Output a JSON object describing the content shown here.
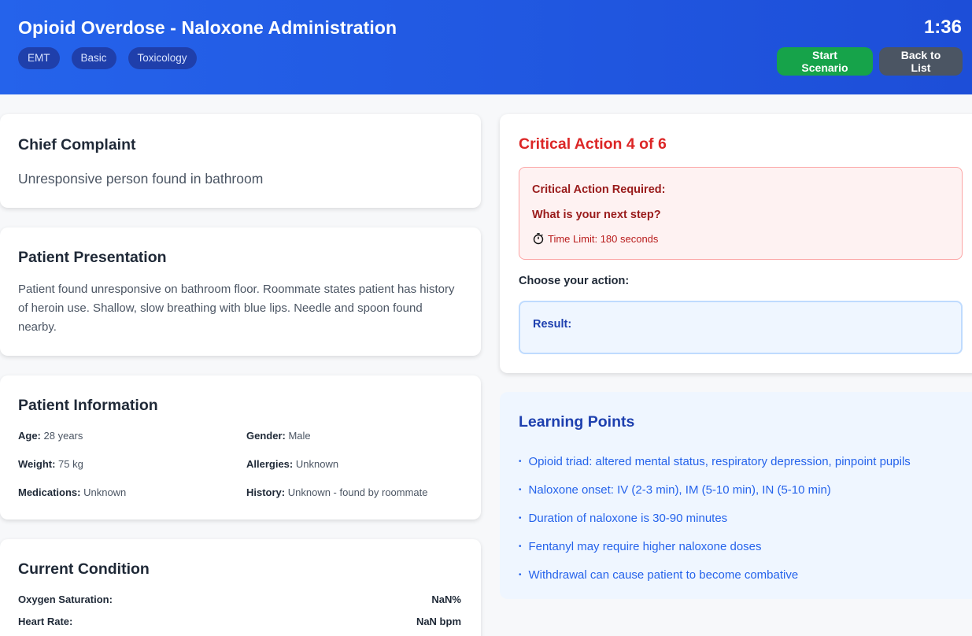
{
  "header": {
    "title": "Opioid Overdose - Naloxone Administration",
    "tags": [
      "EMT",
      "Basic",
      "Toxicology"
    ],
    "timer": "1:36",
    "start_label": "Start Scenario",
    "back_label": "Back to List"
  },
  "chief_complaint": {
    "heading": "Chief Complaint",
    "text": "Unresponsive person found in bathroom"
  },
  "presentation": {
    "heading": "Patient Presentation",
    "text": "Patient found unresponsive on bathroom floor. Roommate states patient has history of heroin use. Shallow, slow breathing with blue lips. Needle and spoon found nearby."
  },
  "patient_info": {
    "heading": "Patient Information",
    "age_label": "Age:",
    "age": "28 years",
    "gender_label": "Gender:",
    "gender": "Male",
    "weight_label": "Weight:",
    "weight": "75 kg",
    "allergies_label": "Allergies:",
    "allergies": "Unknown",
    "medications_label": "Medications:",
    "medications": "Unknown",
    "history_label": "History:",
    "history": "Unknown - found by roommate"
  },
  "condition": {
    "heading": "Current Condition",
    "vitals": [
      {
        "label": "Oxygen Saturation:",
        "value": "NaN%"
      },
      {
        "label": "Heart Rate:",
        "value": "NaN bpm"
      }
    ]
  },
  "critical_action": {
    "heading": "Critical Action 4 of 6",
    "required": "Critical Action Required:",
    "question": "What is your next step?",
    "time_limit": "Time Limit: 180 seconds",
    "choose": "Choose your action:",
    "result_label": "Result:"
  },
  "learning_points": {
    "heading": "Learning Points",
    "items": [
      "Opioid triad: altered mental status, respiratory depression, pinpoint pupils",
      "Naloxone onset: IV (2-3 min), IM (5-10 min), IN (5-10 min)",
      "Duration of naloxone is 30-90 minutes",
      "Fentanyl may require higher naloxone doses",
      "Withdrawal can cause patient to become combative"
    ]
  }
}
